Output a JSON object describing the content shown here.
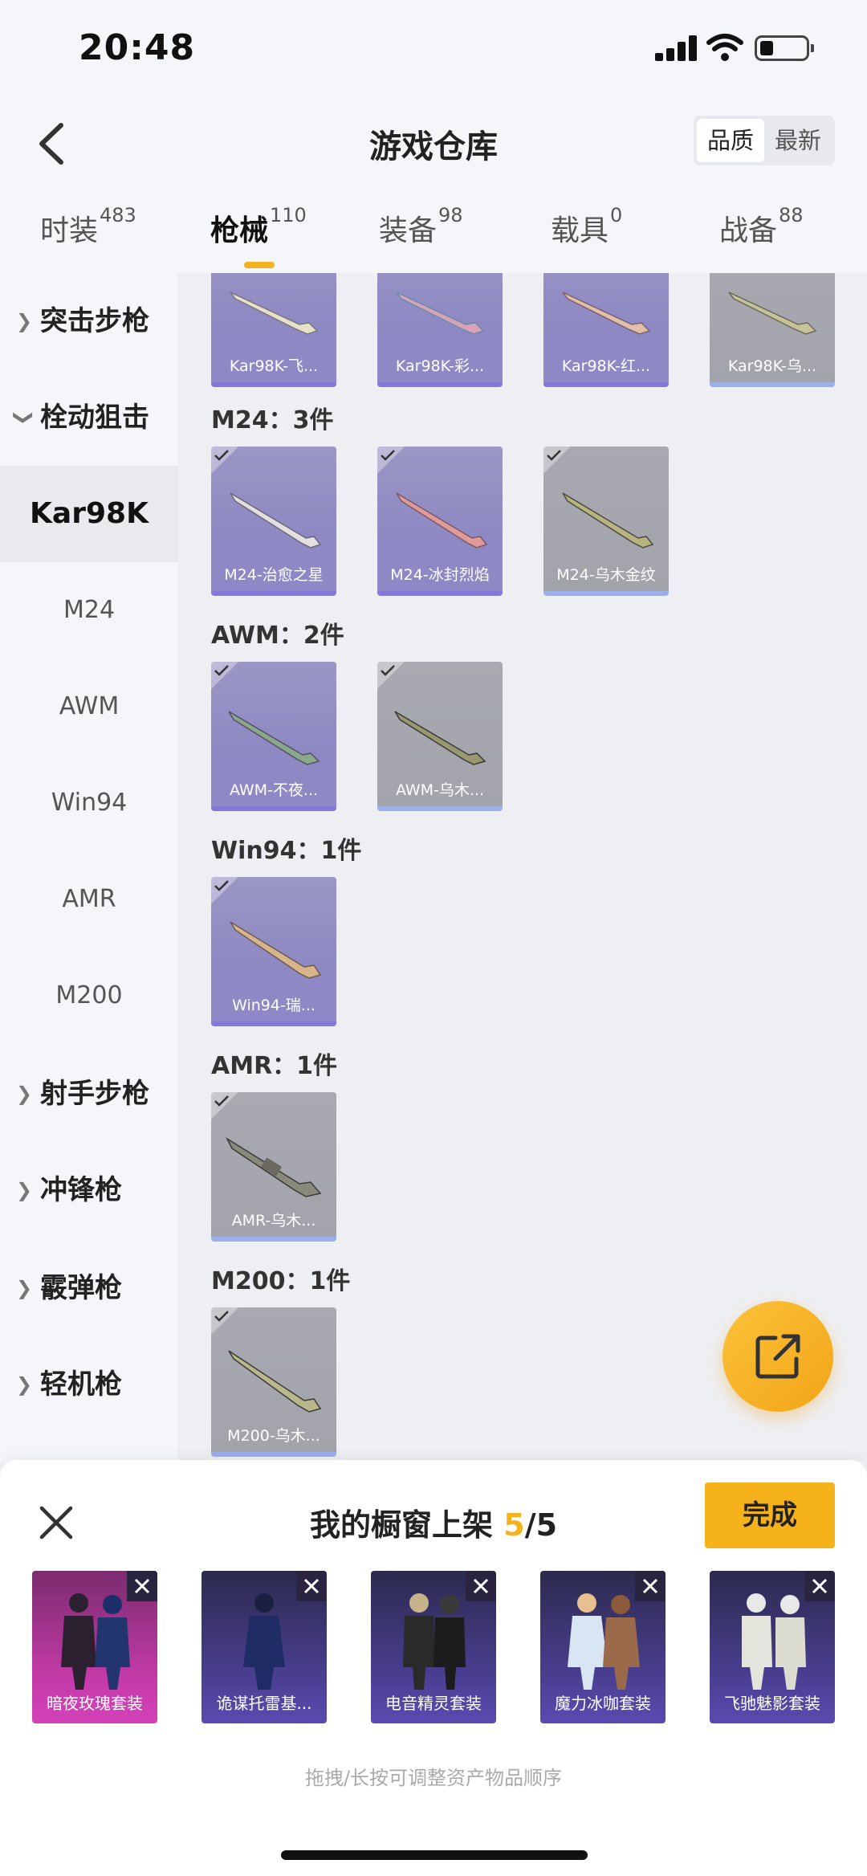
{
  "status": {
    "time": "20:48"
  },
  "header": {
    "title": "游戏仓库",
    "sort_quality": "品质",
    "sort_newest": "最新"
  },
  "tabs": [
    {
      "label": "时装",
      "count": "483"
    },
    {
      "label": "枪械",
      "count": "110"
    },
    {
      "label": "装备",
      "count": "98"
    },
    {
      "label": "载具",
      "count": "0"
    },
    {
      "label": "战备",
      "count": "88"
    }
  ],
  "sidebar": {
    "items": [
      {
        "label": "突击步枪"
      },
      {
        "label": "栓动狙击"
      },
      {
        "label": "Kar98K"
      },
      {
        "label": "M24"
      },
      {
        "label": "AWM"
      },
      {
        "label": "Win94"
      },
      {
        "label": "AMR"
      },
      {
        "label": "M200"
      },
      {
        "label": "射手步枪"
      },
      {
        "label": "冲锋枪"
      },
      {
        "label": "霰弹枪"
      },
      {
        "label": "轻机枪"
      }
    ]
  },
  "sections": {
    "kar98k": {
      "items": [
        "Kar98K-飞...",
        "Kar98K-彩...",
        "Kar98K-红...",
        "Kar98K-乌..."
      ]
    },
    "m24": {
      "title": "M24：3件",
      "items": [
        "M24-治愈之星",
        "M24-冰封烈焰",
        "M24-乌木金纹"
      ]
    },
    "awm": {
      "title": "AWM：2件",
      "items": [
        "AWM-不夜...",
        "AWM-乌木..."
      ]
    },
    "win94": {
      "title": "Win94：1件",
      "items": [
        "Win94-瑞..."
      ]
    },
    "amr": {
      "title": "AMR：1件",
      "items": [
        "AMR-乌木..."
      ]
    },
    "m200": {
      "title": "M200：1件",
      "items": [
        "M200-乌木..."
      ]
    }
  },
  "panel": {
    "title": "我的橱窗上架",
    "count_current": "5",
    "count_total": "/5",
    "done_label": "完成",
    "showcase": [
      "暗夜玫瑰套装",
      "诡谋托雷基...",
      "电音精灵套装",
      "魔力冰咖套装",
      "飞驰魅影套装"
    ],
    "hint": "拖拽/长按可调整资产物品顺序"
  }
}
